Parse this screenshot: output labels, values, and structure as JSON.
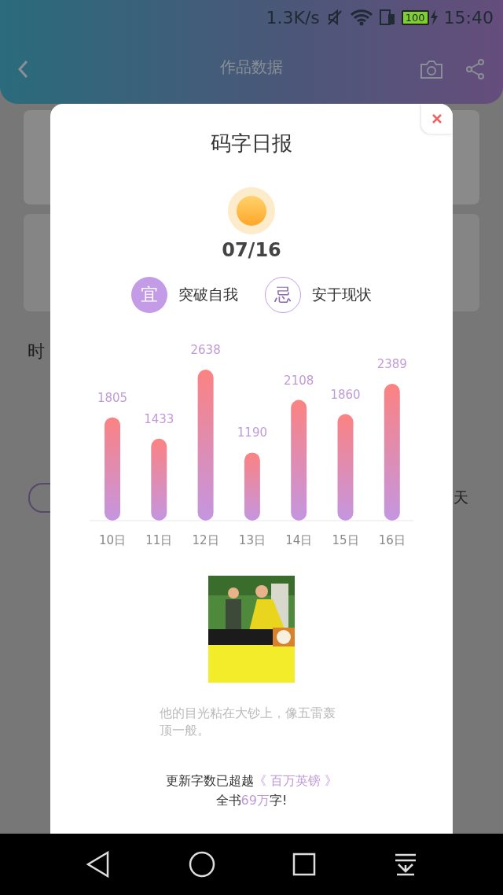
{
  "status_bar": {
    "speed": "1.3K/s",
    "battery": "100",
    "time": "15:40"
  },
  "header": {
    "title": "作品数据"
  },
  "background": {
    "section_label": "时",
    "unit_label": "天"
  },
  "report": {
    "title": "码字日报",
    "date": "07/16",
    "advice": [
      {
        "kind": "yi",
        "mark": "宜",
        "text": "突破自我"
      },
      {
        "kind": "ji",
        "mark": "忌",
        "text": "安于现状"
      }
    ],
    "chart_data": {
      "type": "bar",
      "categories": [
        "10日",
        "11日",
        "12日",
        "13日",
        "14日",
        "15日",
        "16日"
      ],
      "values": [
        1805,
        1433,
        2638,
        1190,
        2108,
        1860,
        2389
      ],
      "data_labels": true
    },
    "book": {
      "kind": "picture"
    },
    "quote": "他的目光粘在大钞上，像五雷轰顶一般。",
    "summary": [
      [
        {
          "text": "更新字数已超越",
          "highlight": false
        },
        {
          "text": "《 百万英镑 》",
          "highlight": true
        }
      ],
      [
        {
          "text": "全书",
          "highlight": false
        },
        {
          "text": "69万",
          "highlight": true
        },
        {
          "text": "字!",
          "highlight": false
        }
      ]
    ]
  }
}
